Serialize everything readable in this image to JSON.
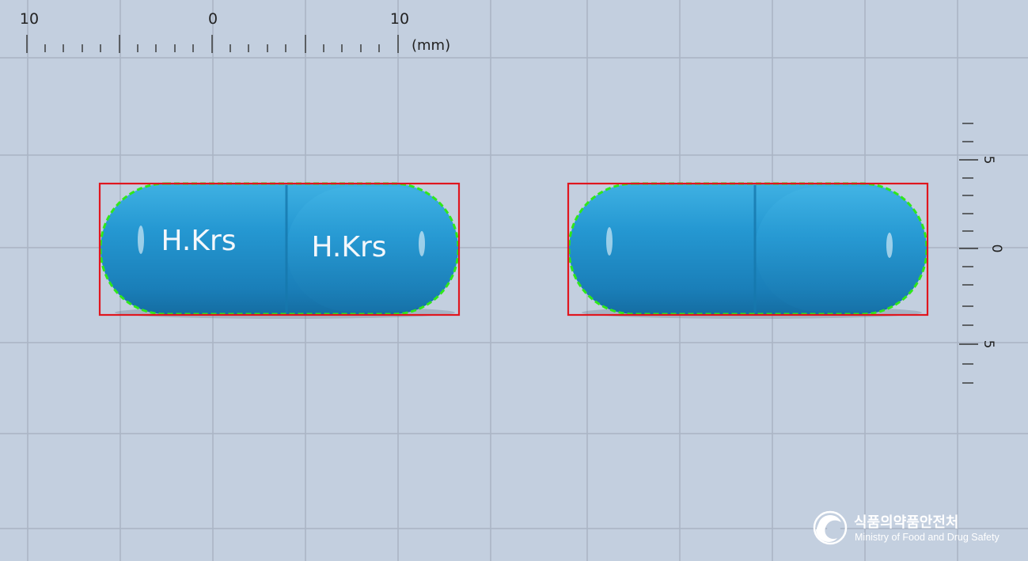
{
  "top_ruler": {
    "labels": [
      "10",
      "0",
      "10"
    ],
    "unit": "(mm)"
  },
  "side_ruler": {
    "labels": [
      "5",
      "0",
      "5"
    ]
  },
  "capsules": [
    {
      "view": "front",
      "imprint_left": "H.Krs",
      "imprint_right": "H.Krs"
    },
    {
      "view": "back",
      "imprint_left": "",
      "imprint_right": ""
    }
  ],
  "logo": {
    "korean": "식품의약품안전처",
    "english": "Ministry of Food and Drug Safety"
  },
  "colors": {
    "background": "#c3cfdf",
    "grid_line": "#a9b4c4",
    "capsule_blue": "#1f95cf",
    "outline_green": "#2fe81a",
    "bbox_red": "#e0161e"
  }
}
